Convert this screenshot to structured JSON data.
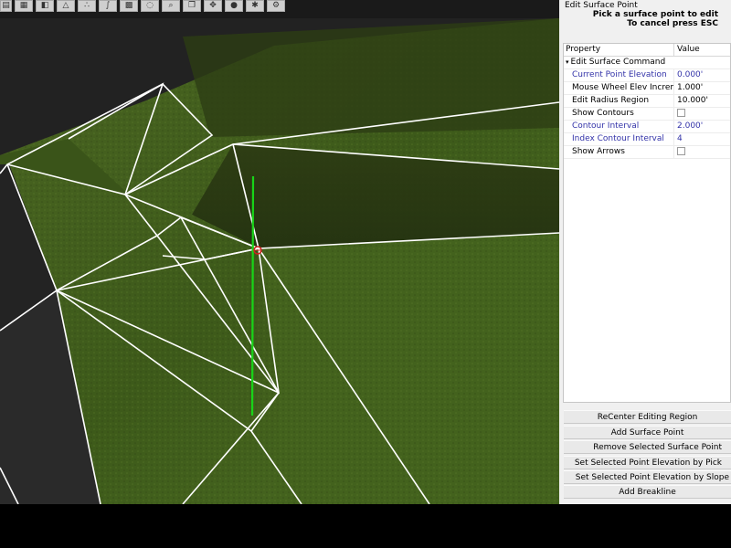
{
  "toolbar": {
    "buttons": [
      "layer-icon",
      "terrain-icon",
      "surface-icon",
      "triangle-icon",
      "points-icon",
      "breakline-icon",
      "map-icon",
      "lasso-icon",
      "zoom-icon",
      "copy-icon",
      "pan-icon",
      "circle-icon",
      "star-icon",
      "settings-icon"
    ]
  },
  "panel": {
    "title": "Edit Surface Point",
    "instruction_line1": "Pick a surface point to edit",
    "instruction_line2": "To cancel press ESC"
  },
  "grid": {
    "header_property": "Property",
    "header_value": "Value",
    "group": "Edit Surface Command",
    "rows": [
      {
        "label": "Current Point Elevation",
        "value": "0.000'"
      },
      {
        "label": "Mouse Wheel Elev Increment",
        "value": "1.000'"
      },
      {
        "label": "Edit Radius Region",
        "value": "10.000'"
      },
      {
        "label": "Show Contours",
        "value": ""
      },
      {
        "label": "Contour Interval",
        "value": "2.000'"
      },
      {
        "label": "Index Contour Interval",
        "value": "4"
      },
      {
        "label": "Show Arrows",
        "value": ""
      }
    ]
  },
  "actions": {
    "recenter": "ReCenter Editing Region",
    "add_point": "Add Surface Point",
    "remove_point": "Remove Selected Surface Point",
    "set_by_pick": "Set Selected Point Elevation by Pick",
    "set_by_slope": "Set Selected Point Elevation by Slope",
    "add_breakline": "Add Breakline"
  },
  "colors": {
    "grass": "#3f5a1c",
    "grass_dark": "#2a3314",
    "asphalt": "#2a2a2a",
    "wire": "#ffffff",
    "elevation_axis": "#18d418",
    "selected_point": "#d02020",
    "blue_text": "#3232a8"
  }
}
